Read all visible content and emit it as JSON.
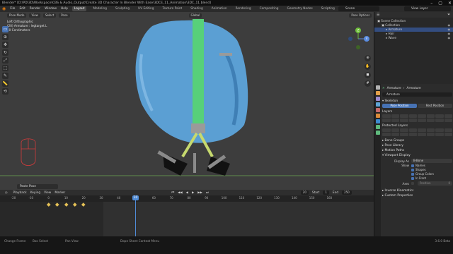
{
  "window": {
    "title": "Blender* [D:\\PD\\3D\\Workspace\\CBS & Audio_Output\\Create 3D Character In Blender With Ease\\3DCE_11_Animation\\3DC_11.blend]",
    "controls": [
      "–",
      "▢",
      "✕"
    ]
  },
  "menu": [
    "File",
    "Edit",
    "Render",
    "Window",
    "Help"
  ],
  "workspaces": [
    {
      "label": "Layout",
      "active": true
    },
    {
      "label": "Modeling",
      "active": false
    },
    {
      "label": "Sculpting",
      "active": false
    },
    {
      "label": "UV Editing",
      "active": false
    },
    {
      "label": "Texture Paint",
      "active": false
    },
    {
      "label": "Shading",
      "active": false
    },
    {
      "label": "Animation",
      "active": false
    },
    {
      "label": "Rendering",
      "active": false
    },
    {
      "label": "Compositing",
      "active": false
    },
    {
      "label": "Geometry Nodes",
      "active": false
    },
    {
      "label": "Scripting",
      "active": false
    }
  ],
  "scene": {
    "label": "Scene",
    "view_layer": "View Layer"
  },
  "viewport": {
    "mode": "Pose Mode",
    "view_menu": [
      "View",
      "Select",
      "Pose"
    ],
    "orientation": "Global",
    "pose_options": "Pose Options",
    "info": [
      "Left Orthographic",
      "(20) Armature : legtarget.L",
      "10 Centimeters"
    ],
    "tools": [
      "select-cursor",
      "cursor",
      "move",
      "rotate",
      "scale",
      "transform",
      "annotate",
      "measure",
      "roll"
    ],
    "nav": [
      "Y",
      "X",
      "Z"
    ],
    "last_operation": "Paste Pose",
    "colors": {
      "bg": "#3d3d3d",
      "fur": "#5b9fd3",
      "bone": "#57d07a",
      "axis": "#6aa84f"
    }
  },
  "timeline": {
    "header": [
      "Playback",
      "Keying",
      "View",
      "Marker"
    ],
    "current_frame": "20",
    "start_label": "Start",
    "start": "1",
    "end_label": "End",
    "end": "250",
    "ruler": [
      "-20",
      "-10",
      "0",
      "10",
      "20",
      "30",
      "40",
      "50",
      "60",
      "70",
      "80",
      "90",
      "100",
      "110",
      "120",
      "130",
      "140",
      "150",
      "160"
    ],
    "keyframes": [
      0,
      5,
      10,
      15,
      20
    ]
  },
  "statusbar": {
    "items": [
      "Change Frame",
      "Box Select",
      "Pan View",
      "Dope Sheet Context Menu"
    ],
    "version": "3.6.0 Beta"
  },
  "outliner": {
    "title": "Scene Collection",
    "rows": [
      {
        "label": "Scene Collection",
        "indent": 0,
        "selected": false
      },
      {
        "label": "Collection",
        "indent": 1,
        "selected": false
      },
      {
        "label": "Armature",
        "indent": 2,
        "selected": true
      },
      {
        "label": "Hair",
        "indent": 2,
        "selected": false
      },
      {
        "label": "Wave",
        "indent": 2,
        "selected": false
      }
    ]
  },
  "properties": {
    "breadcrumb": [
      "Armature",
      "Armature"
    ],
    "data_name": "Armature",
    "skeleton": "Skeleton",
    "pose_position": "Pose Position",
    "rest_position": "Rest Position",
    "layers": "Layers",
    "protected_layers": "Protected Layers",
    "sections": [
      "Bone Groups",
      "Pose Library",
      "Motion Paths",
      "Viewport Display"
    ],
    "display_as_label": "Display As",
    "display_as": "B-Bone",
    "show_label": "Show",
    "show_items": [
      "Names",
      "Shapes",
      "Group Colors",
      "In Front"
    ],
    "axes_label": "Axes",
    "position_label": "Position",
    "position_value": "0",
    "footer_sections": [
      "Inverse Kinematics",
      "Custom Properties"
    ]
  }
}
